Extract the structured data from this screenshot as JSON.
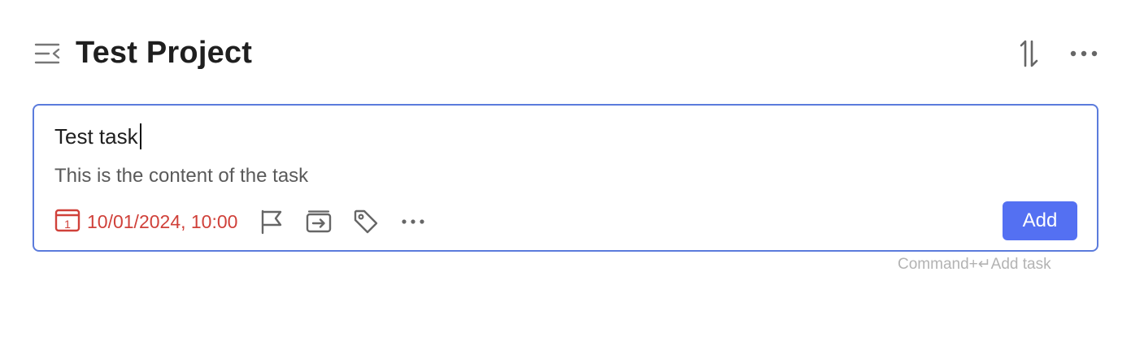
{
  "header": {
    "menu_icon": "menu-collapse-icon",
    "title": "Test Project",
    "sort_icon": "sort-icon",
    "more_icon": "more-horizontal-icon"
  },
  "editor": {
    "title_value": "Test task",
    "content_value": "This is the content of the task",
    "date": {
      "icon": "calendar-icon",
      "calendar_day": "1",
      "text": "10/01/2024, 10:00",
      "color": "#d0413a"
    },
    "tools": [
      {
        "icon": "flag-icon"
      },
      {
        "icon": "move-to-icon"
      },
      {
        "icon": "tag-icon"
      },
      {
        "icon": "more-horizontal-icon"
      }
    ],
    "add_label": "Add",
    "accent": "#5470f2",
    "border_color": "#5b7bdc"
  },
  "hint": {
    "shortcut": "Command+↵Add task"
  }
}
